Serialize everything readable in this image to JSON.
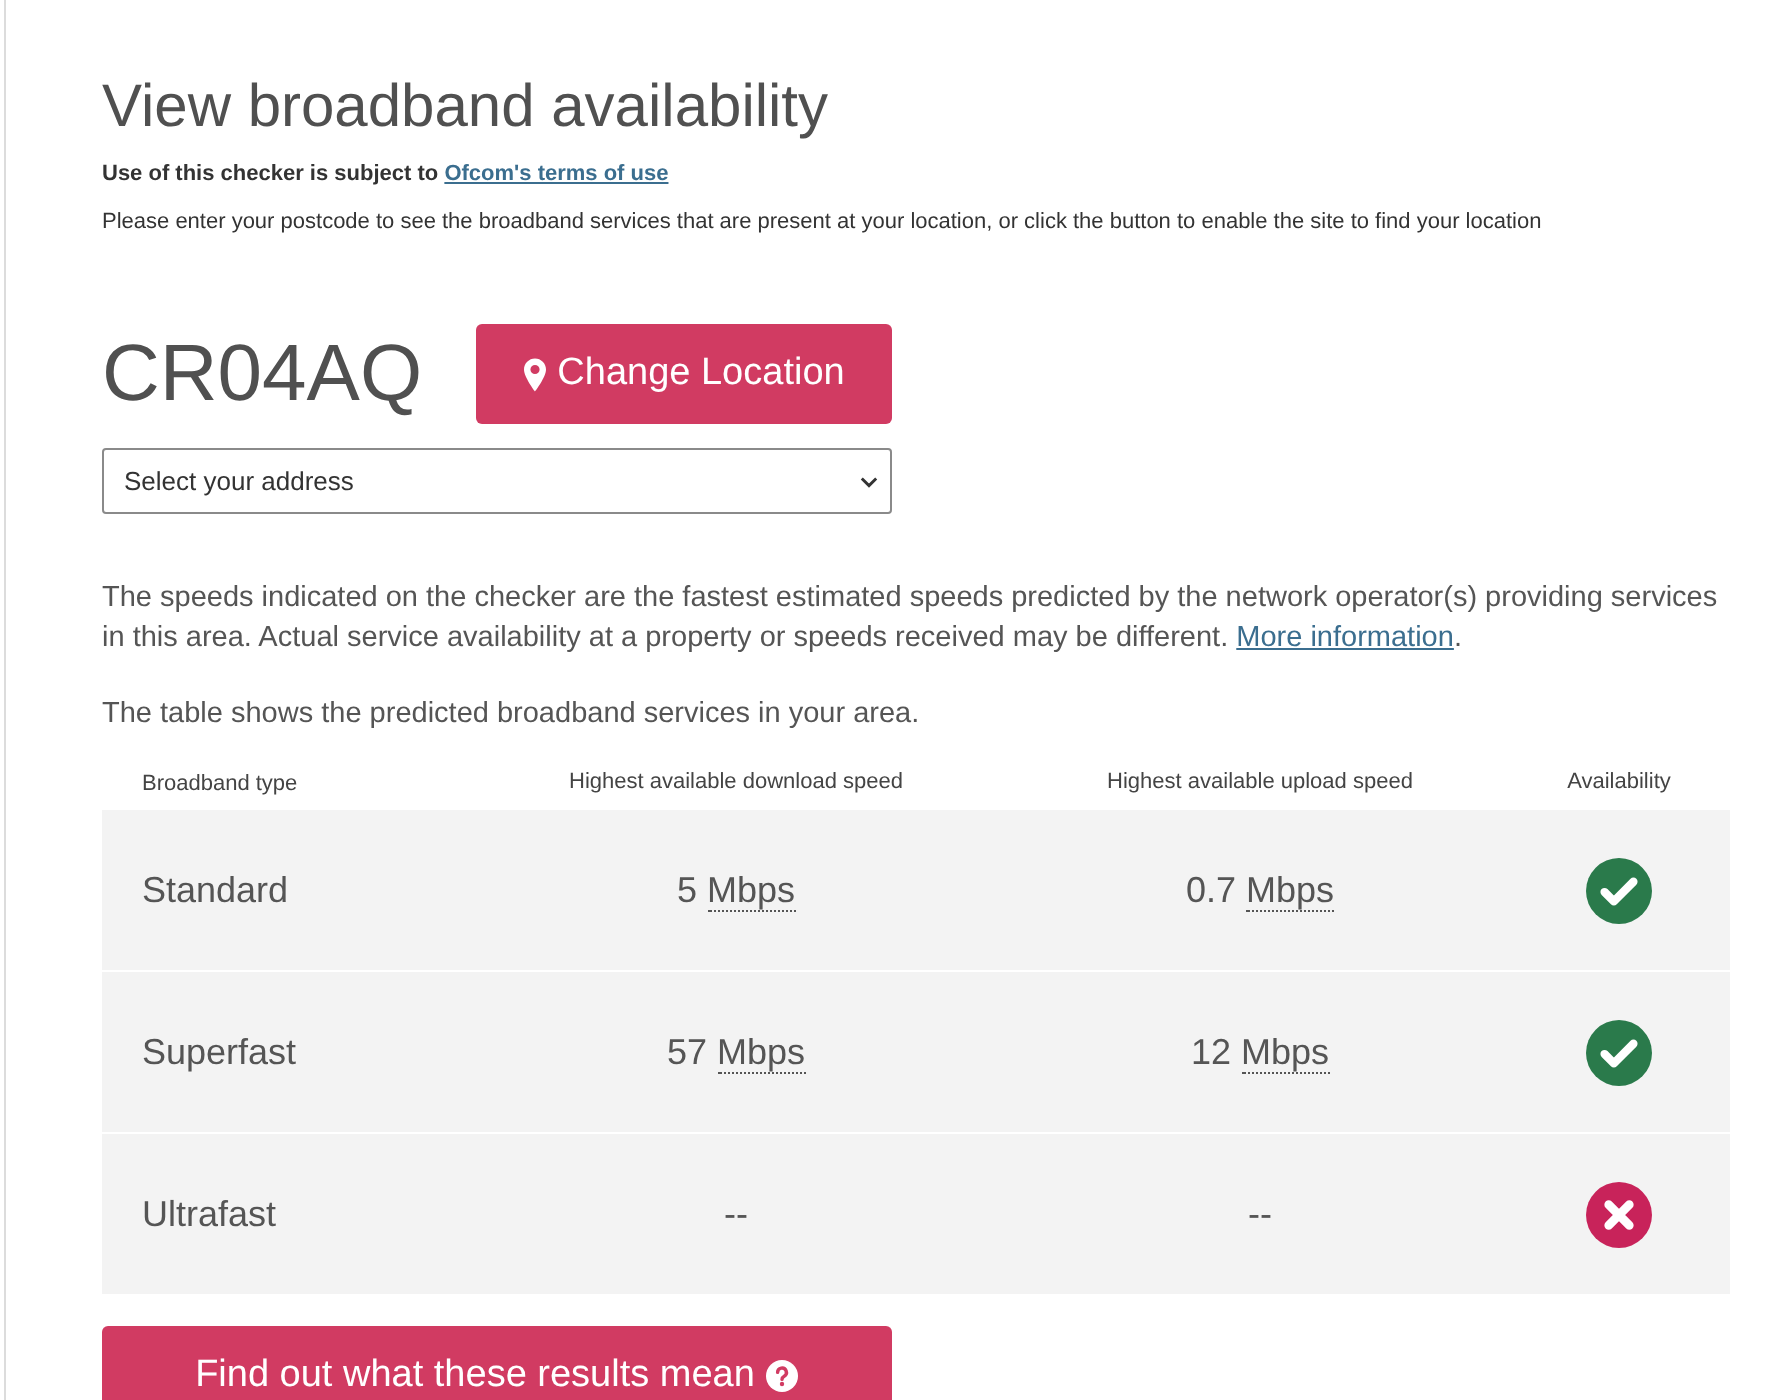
{
  "page": {
    "title": "View broadband availability",
    "terms": {
      "text": "Use of this checker is subject to",
      "link": "Ofcom's terms of use"
    },
    "instructions": "Please enter your postcode to see the broadband services that are present at your location, or click the button to enable the site to find your location"
  },
  "location": {
    "postcode": "CR04AQ",
    "change_button": "Change Location",
    "address_select": {
      "placeholder": "Select your address"
    }
  },
  "disclaimer": {
    "text": "The speeds indicated on the checker are the fastest estimated speeds predicted by the network operator(s) providing services in this area. Actual service availability at a property or speeds received may be different.",
    "link": "More information",
    "suffix": "."
  },
  "table_intro": "The table shows the predicted broadband services in your area.",
  "table": {
    "columns": [
      "Broadband type",
      "Highest available download speed",
      "Highest available upload speed",
      "Availability"
    ],
    "rows": [
      {
        "type": "Standard",
        "download": {
          "value": "5",
          "unit": "Mbps"
        },
        "upload": {
          "value": "0.7",
          "unit": "Mbps"
        },
        "available": true
      },
      {
        "type": "Superfast",
        "download": {
          "value": "57",
          "unit": "Mbps"
        },
        "upload": {
          "value": "12",
          "unit": "Mbps"
        },
        "available": true
      },
      {
        "type": "Ultrafast",
        "download": {
          "value": "--"
        },
        "upload": {
          "value": "--"
        },
        "available": false
      }
    ]
  },
  "results_button": "Find out what these results mean"
}
